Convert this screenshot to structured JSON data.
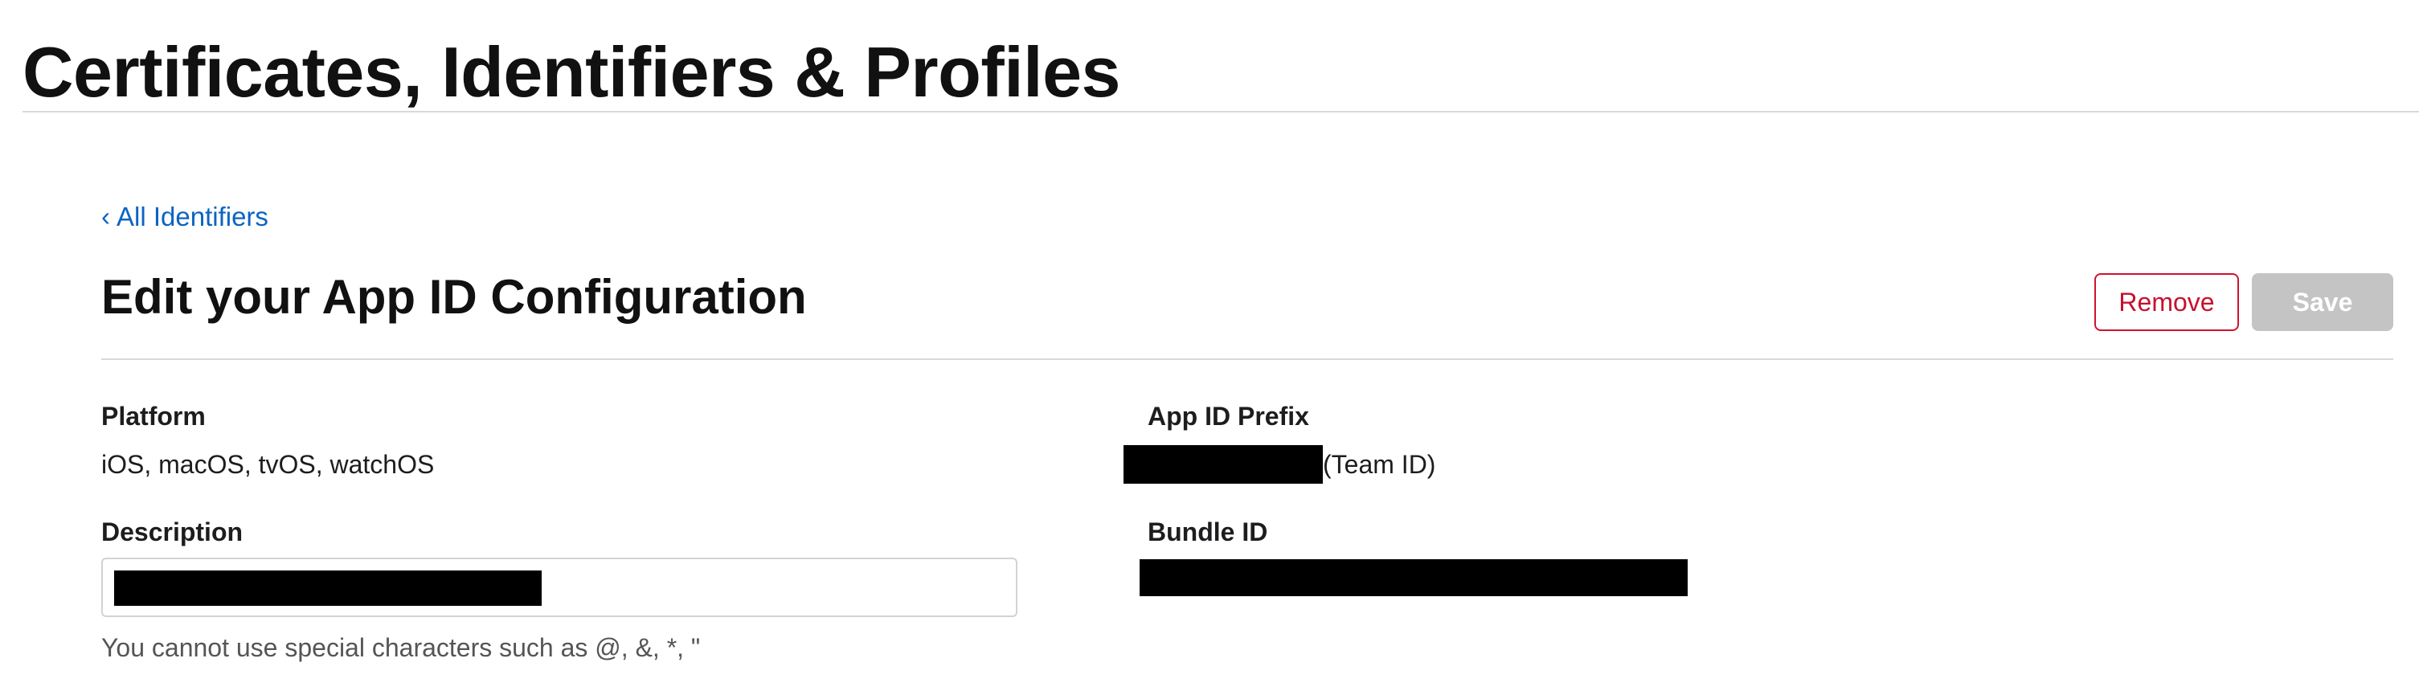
{
  "header": {
    "title": "Certificates, Identifiers & Profiles"
  },
  "nav": {
    "back_chevron": "‹",
    "back_label": "All Identifiers"
  },
  "section": {
    "title": "Edit your App ID Configuration"
  },
  "actions": {
    "remove_label": "Remove",
    "save_label": "Save",
    "save_enabled": false
  },
  "fields": {
    "platform": {
      "label": "Platform",
      "value": "iOS, macOS, tvOS, watchOS"
    },
    "app_id_prefix": {
      "label": "App ID Prefix",
      "suffix": "(Team ID)",
      "value_redacted": true
    },
    "description": {
      "label": "Description",
      "value_redacted": true,
      "hint": "You cannot use special characters such as @, &, *, \""
    },
    "bundle_id": {
      "label": "Bundle ID",
      "value_redacted": true
    }
  },
  "colors": {
    "link": "#0a64c2",
    "danger": "#c8102e",
    "disabled_button": "#c4c4c4",
    "redaction": "#000000"
  }
}
